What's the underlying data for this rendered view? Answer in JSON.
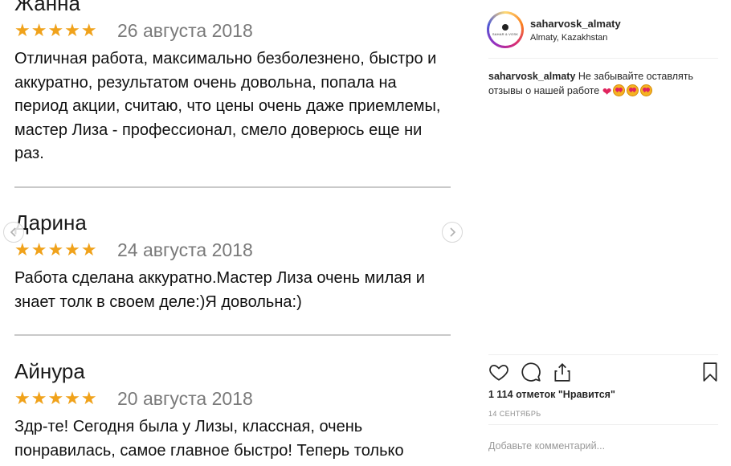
{
  "reviews": [
    {
      "name": "Жанна",
      "stars": "★★★★★",
      "date": "26 августа 2018",
      "text": "Отличная работа, максимально безболезнено, быстро и аккуратно, результатом очень довольна, попала на период акции, считаю, что цены очень даже приемлемы, мастер Лиза - профессионал, смело доверюсь еще ни раз."
    },
    {
      "name": "Дарина",
      "stars": "★★★★★",
      "date": "24 августа 2018",
      "text": "Работа сделана аккуратно.Мастер Лиза очень милая и знает толк в своем деле:)Я довольна:)"
    },
    {
      "name": "Айнура",
      "stars": "★★★★★",
      "date": "20 августа 2018",
      "text": "Здр-те! Сегодня была у Лизы, классная, очень понравилась, самое главное быстро! Теперь только"
    }
  ],
  "colors": {
    "star": "#f0a21b",
    "date_gray": "#7a7a7a",
    "divider": "#c9c9c9",
    "heart": "#e0245e"
  },
  "post": {
    "avatar_text": "SAHAR & VOSK",
    "username": "saharvosk_almaty",
    "location": "Almaty, Kazakhstan",
    "caption_user": "saharvosk_almaty",
    "caption_text": "Не забывайте оставлять отзывы о нашей работе",
    "caption_emojis": [
      "heart",
      "heart-eyes-face",
      "heart-eyes-face",
      "heart-eyes-face"
    ],
    "likes": "1 114 отметок \"Нравится\"",
    "date": "14 СЕНТЯБРЬ",
    "comment_placeholder": "Добавьте комментарий..."
  },
  "icons": {
    "like": "heart-outline-icon",
    "comment": "speech-bubble-icon",
    "share": "share-upload-icon",
    "save": "bookmark-icon",
    "prev": "chevron-left-icon",
    "next": "chevron-right-icon"
  }
}
